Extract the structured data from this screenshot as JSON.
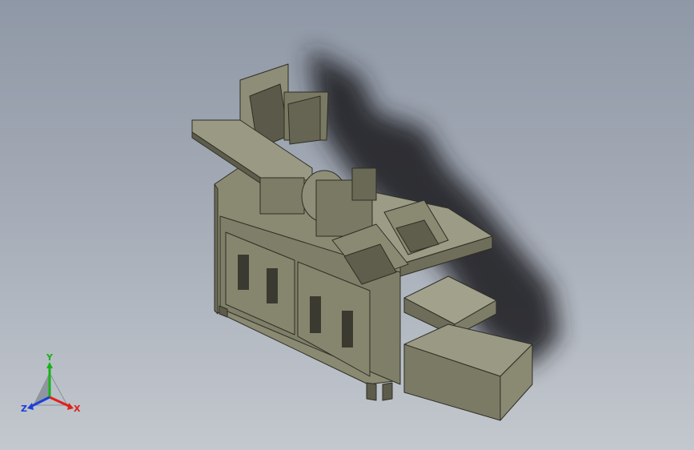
{
  "triad": {
    "x_label": "X",
    "y_label": "Y",
    "z_label": "Z",
    "x_color": "#e0201c",
    "y_color": "#18b21a",
    "z_color": "#1d3fd8"
  },
  "model": {
    "body_color": "#7f7e68",
    "dark_color": "#4c4b3e",
    "light_color": "#9c9b86",
    "shadow_color": "#202225"
  }
}
